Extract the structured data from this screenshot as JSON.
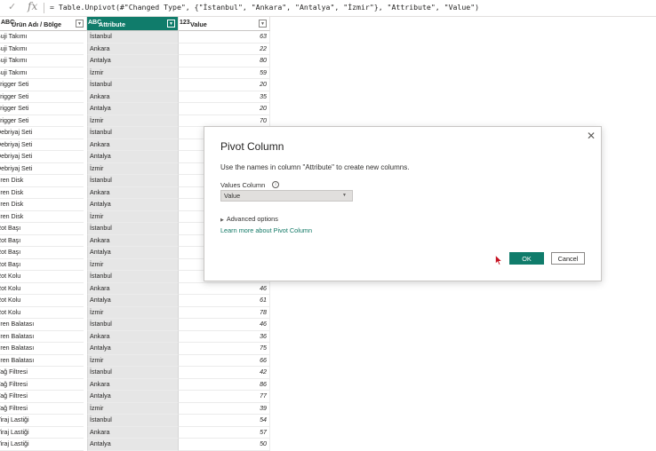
{
  "formula_bar": {
    "check_icon": "check-icon",
    "fx_label": "fx",
    "formula": "= Table.Unpivot(#\"Changed Type\", {\"İstanbul\", \"Ankara\", \"Antalya\", \"İzmir\"}, \"Attribute\", \"Value\")"
  },
  "grid": {
    "columns": [
      {
        "type_icon": "ABC",
        "name": "Ürün Adı / Bölge"
      },
      {
        "type_icon": "ABC",
        "name": "Attribute"
      },
      {
        "type_icon": "123",
        "name": "Value"
      }
    ],
    "rows": [
      [
        "Buji Takımı",
        "İstanbul",
        "63"
      ],
      [
        "Buji Takımı",
        "Ankara",
        "22"
      ],
      [
        "Buji Takımı",
        "Antalya",
        "80"
      ],
      [
        "Buji Takımı",
        "İzmir",
        "59"
      ],
      [
        "Trigger Seti",
        "İstanbul",
        "20"
      ],
      [
        "Trigger Seti",
        "Ankara",
        "35"
      ],
      [
        "Trigger Seti",
        "Antalya",
        "20"
      ],
      [
        "Trigger Seti",
        "İzmir",
        "70"
      ],
      [
        "Debriyaj Seti",
        "İstanbul",
        ""
      ],
      [
        "Debriyaj Seti",
        "Ankara",
        ""
      ],
      [
        "Debriyaj Seti",
        "Antalya",
        ""
      ],
      [
        "Debriyaj Seti",
        "İzmir",
        ""
      ],
      [
        "Fren Disk",
        "İstanbul",
        ""
      ],
      [
        "Fren Disk",
        "Ankara",
        ""
      ],
      [
        "Fren Disk",
        "Antalya",
        ""
      ],
      [
        "Fren Disk",
        "İzmir",
        ""
      ],
      [
        "Rot Başı",
        "İstanbul",
        ""
      ],
      [
        "Rot Başı",
        "Ankara",
        ""
      ],
      [
        "Rot Başı",
        "Antalya",
        ""
      ],
      [
        "Rot Başı",
        "İzmir",
        ""
      ],
      [
        "Rot Kolu",
        "İstanbul",
        ""
      ],
      [
        "Rot Kolu",
        "Ankara",
        "46"
      ],
      [
        "Rot Kolu",
        "Antalya",
        "61"
      ],
      [
        "Rot Kolu",
        "İzmir",
        "78"
      ],
      [
        "Fren Balatası",
        "İstanbul",
        "46"
      ],
      [
        "Fren Balatası",
        "Ankara",
        "36"
      ],
      [
        "Fren Balatası",
        "Antalya",
        "75"
      ],
      [
        "Fren Balatası",
        "İzmir",
        "66"
      ],
      [
        "Yağ Filtresi",
        "İstanbul",
        "42"
      ],
      [
        "Yağ Filtresi",
        "Ankara",
        "86"
      ],
      [
        "Yağ Filtresi",
        "Antalya",
        "77"
      ],
      [
        "Yağ Filtresi",
        "İzmir",
        "39"
      ],
      [
        "Viraj Lastiği",
        "İstanbul",
        "54"
      ],
      [
        "Viraj Lastiği",
        "Ankara",
        "57"
      ],
      [
        "Viraj Lastiği",
        "Antalya",
        "50"
      ]
    ]
  },
  "dialog": {
    "title": "Pivot Column",
    "close_icon": "close-icon",
    "description": "Use the names in column \"Attribute\" to create new columns.",
    "values_column_label": "Values Column",
    "info_icon": "i",
    "values_column_selected": "Value",
    "advanced_options": "Advanced options",
    "learn_more": "Learn more about Pivot Column",
    "ok_label": "OK",
    "cancel_label": "Cancel"
  },
  "colors": {
    "accent": "#107c6b",
    "cursor": "#c50f1f"
  }
}
